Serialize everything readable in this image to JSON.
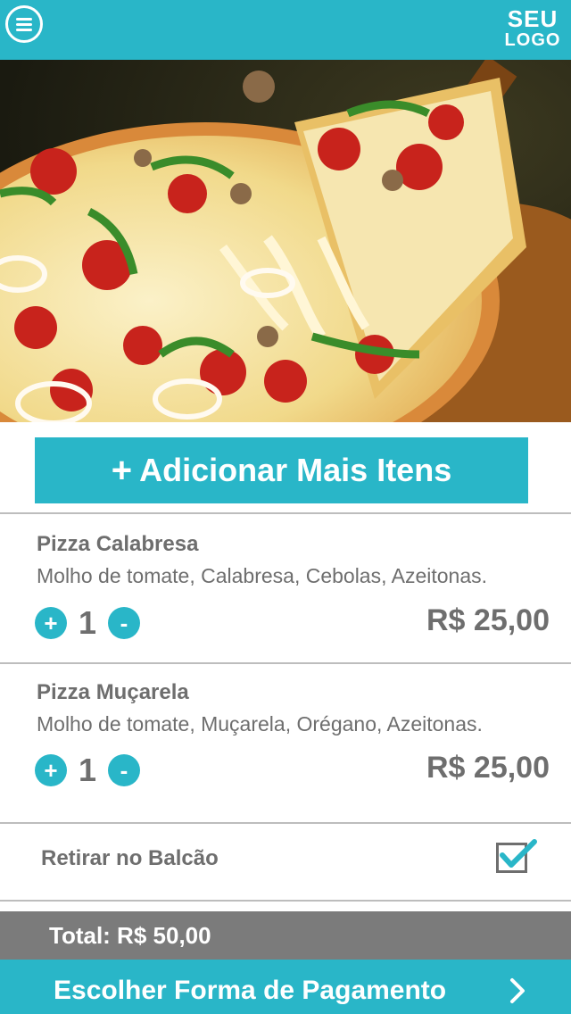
{
  "header": {
    "menu_icon": "hamburger-menu-icon",
    "logo_line1": "SEU",
    "logo_line2": "LOGO",
    "brand_color": "#29b6c8"
  },
  "hero": {
    "image": "pizza-photo"
  },
  "add_button": {
    "plus": "+",
    "label": "Adicionar Mais Itens"
  },
  "cart": {
    "items": [
      {
        "name": "Pizza Calabresa",
        "description": "Molho de tomate, Calabresa, Cebolas, Azeitonas.",
        "increment": "+",
        "quantity": "1",
        "decrement": "-",
        "price": "R$ 25,00"
      },
      {
        "name": "Pizza Muçarela",
        "description": "Molho de tomate, Muçarela, Orégano, Azeitonas.",
        "increment": "+",
        "quantity": "1",
        "decrement": "-",
        "price": "R$ 25,00"
      }
    ]
  },
  "pickup": {
    "label": "Retirar no Balcão",
    "checked": true
  },
  "footer": {
    "total": "Total: R$ 50,00",
    "pay_label": "Escolher Forma de Pagamento",
    "pay_icon": "chevron-right-icon",
    "total_bar_color": "#7b7b7b"
  }
}
